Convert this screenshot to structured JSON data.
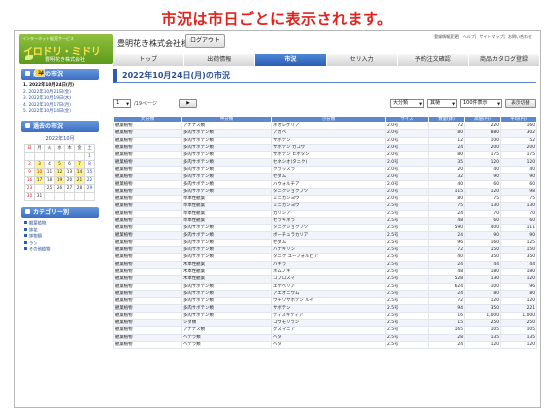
{
  "headline": "市況は市日ごとに表示されます。",
  "brand": {
    "tagline": "インターネット販売サービス",
    "name": "イロドリ・ミドリ",
    "company_small": "豊明花き株式会社"
  },
  "header": {
    "company": "豊明花き株式会社様",
    "logout_label": "ログアウト",
    "links": [
      "登録情報変更",
      "ヘルプ",
      "サイトマップ",
      "お問い合わせ"
    ]
  },
  "nav": {
    "tabs": [
      "トップ",
      "出荷情報",
      "市況",
      "セリ入力",
      "予約注文確認",
      "商品カタログ登録"
    ],
    "active": "市況"
  },
  "sidebar": {
    "recent_title": "最近の市況",
    "recent_items": [
      "1. 2022年10月24日(月)",
      "2. 2022年10月21日(金)",
      "3. 2022年10月19日(水)",
      "4. 2022年10月17日(月)",
      "5. 2022年10月14日(金)"
    ],
    "past_title": "過去の市況",
    "calendar": {
      "month": "2022年10月",
      "weekdays": [
        "日",
        "月",
        "火",
        "水",
        "木",
        "金",
        "土"
      ],
      "weeks": [
        [
          "",
          "",
          "",
          "",
          "",
          "",
          "1"
        ],
        [
          "2",
          "3",
          "4",
          "5",
          "6",
          "7",
          "8"
        ],
        [
          "9",
          "10",
          "11",
          "12",
          "13",
          "14",
          "15"
        ],
        [
          "16",
          "17",
          "18",
          "19",
          "20",
          "21",
          "22"
        ],
        [
          "23",
          "24",
          "25",
          "26",
          "27",
          "28",
          "29"
        ],
        [
          "30",
          "31",
          "",
          "",
          "",
          "",
          ""
        ]
      ]
    },
    "category_title": "カテゴリー別",
    "categories": [
      "観葉植物",
      "鉢花",
      "鉢物類",
      "ラン",
      "その他植物"
    ]
  },
  "main": {
    "page_title": "2022年10月24日(月)の市況",
    "page_select": "1",
    "page_total": "/19ページ",
    "next_label": "▶",
    "filter1": "大分類",
    "filter2": "其樋",
    "filter3": "100件表示",
    "display_label": "表示切替",
    "columns": [
      "大分類",
      "中分類",
      "小分類",
      "サイズ",
      "数量(鉢)",
      "高値(円)",
      "平均(円)"
    ],
    "rows": [
      [
        "観葉植物",
        "アナナス類",
        "ネオレゲリア",
        "2.0号",
        "72",
        "220",
        "160"
      ],
      [
        "観葉植物",
        "多肉サボテン類",
        "アガベ",
        "2.0号",
        "80",
        "880",
        "302"
      ],
      [
        "観葉植物",
        "多肉サボテン類",
        "サボテン",
        "2.0号",
        "12",
        "100",
        "52"
      ],
      [
        "観葉植物",
        "多肉サボテン類",
        "サボテン カコウ",
        "2.0号",
        "24",
        "200",
        "200"
      ],
      [
        "観葉植物",
        "多肉サボテン類",
        "サボテン ヒボタン",
        "2.0号",
        "80",
        "175",
        "175"
      ],
      [
        "観葉植物",
        "多肉サボテン類",
        "セネシオ(タニク)",
        "2.0号",
        "35",
        "120",
        "120"
      ],
      [
        "観葉植物",
        "多肉サボテン類",
        "クラッスラ",
        "2.0号",
        "20",
        "40",
        "40"
      ],
      [
        "観葉植物",
        "多肉サボテン類",
        "セダム",
        "2.0号",
        "32",
        "90",
        "90"
      ],
      [
        "観葉植物",
        "多肉サボテン類",
        "ハウォルチア",
        "2.0号",
        "40",
        "60",
        "60"
      ],
      [
        "観葉植物",
        "多肉サボテン類",
        "タニクショクブツ",
        "2.0号",
        "115",
        "120",
        "98"
      ],
      [
        "観葉植物",
        "草本性観葉",
        "ミニカンヨウ",
        "2.0号",
        "80",
        "75",
        "75"
      ],
      [
        "観葉植物",
        "草本性観葉",
        "ミニカンヨウ",
        "2.5号",
        "75",
        "130",
        "130"
      ],
      [
        "観葉植物",
        "草本性観葉",
        "カリシア",
        "2.5号",
        "24",
        "70",
        "70"
      ],
      [
        "観葉植物",
        "草本性観葉",
        "セラギネラ",
        "2.5号",
        "48",
        "60",
        "60"
      ],
      [
        "観葉植物",
        "多肉サボテン類",
        "タニクショクブツ",
        "2.5号",
        "590",
        "400",
        "111"
      ],
      [
        "観葉植物",
        "多肉サボテン類",
        "ボーチュラカリア",
        "2.5号",
        "24",
        "90",
        "90"
      ],
      [
        "観葉植物",
        "多肉サボテン類",
        "セダム",
        "2.5号",
        "96",
        "160",
        "125"
      ],
      [
        "観葉植物",
        "多肉サボテン類",
        "ハナキリン",
        "2.5号",
        "72",
        "150",
        "150"
      ],
      [
        "観葉植物",
        "多肉サボテン類",
        "タニク ユーフォルビア",
        "2.5号",
        "40",
        "350",
        "350"
      ],
      [
        "観葉植物",
        "木本性観葉",
        "パキラ",
        "2.5号",
        "24",
        "44",
        "44"
      ],
      [
        "観葉植物",
        "木本性観葉",
        "ネムノキ",
        "2.5号",
        "48",
        "180",
        "180"
      ],
      [
        "観葉植物",
        "木本性観葉",
        "コプロスマ",
        "2.5号",
        "528",
        "130",
        "120"
      ],
      [
        "観葉植物",
        "多肉サボテン類",
        "エケベリア",
        "2.5号",
        "624",
        "100",
        "96"
      ],
      [
        "観葉植物",
        "多肉サボテン類",
        "アエオニウム",
        "2.5号",
        "24",
        "80",
        "80"
      ],
      [
        "観葉植物",
        "多肉サボテン類",
        "ウチワサボテン ルイ",
        "2.5号",
        "72",
        "120",
        "120"
      ],
      [
        "観葉植物",
        "多肉サボテン類",
        "サボテン",
        "2.5号",
        "94",
        "350",
        "221"
      ],
      [
        "観葉植物",
        "多肉サボテン類",
        "ディスキディア",
        "2.5号",
        "16",
        "1,000",
        "1,000"
      ],
      [
        "観葉植物",
        "シダ類",
        "コウモリラン",
        "2.5号",
        "15",
        "250",
        "250"
      ],
      [
        "観葉植物",
        "アナナス類",
        "グズマニア",
        "2.5号",
        "165",
        "105",
        "105"
      ],
      [
        "観葉植物",
        "ヘデラ類",
        "ヘタ",
        "2.5号",
        "28",
        "135",
        "135"
      ],
      [
        "観葉植物",
        "ヘデラ類",
        "ヘタ",
        "2.5号",
        "24",
        "120",
        "120"
      ]
    ]
  }
}
